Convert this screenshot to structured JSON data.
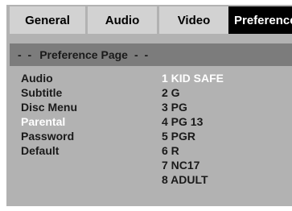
{
  "tabs": [
    {
      "label": "General",
      "active": false
    },
    {
      "label": "Audio",
      "active": false
    },
    {
      "label": "Video",
      "active": false
    },
    {
      "label": "Preference",
      "active": true
    }
  ],
  "page": {
    "title": "Preference Page",
    "prefix": "- -",
    "suffix": "- -"
  },
  "menu": {
    "items": [
      {
        "label": "Audio",
        "active": false
      },
      {
        "label": "Subtitle",
        "active": false
      },
      {
        "label": "Disc Menu",
        "active": false
      },
      {
        "label": "Parental",
        "active": true
      },
      {
        "label": "Password",
        "active": false
      },
      {
        "label": "Default",
        "active": false
      }
    ]
  },
  "options": {
    "items": [
      {
        "label": "1 KID SAFE",
        "selected": true
      },
      {
        "label": "2 G",
        "selected": false
      },
      {
        "label": "3 PG",
        "selected": false
      },
      {
        "label": "4 PG 13",
        "selected": false
      },
      {
        "label": "5 PGR",
        "selected": false
      },
      {
        "label": "6 R",
        "selected": false
      },
      {
        "label": "7 NC17",
        "selected": false
      },
      {
        "label": "8 ADULT",
        "selected": false
      }
    ]
  },
  "colors": {
    "panel": "#b2b2b2",
    "tab": "#d2d2d2",
    "active_tab": "#000000",
    "page_bar": "#7c7c7c",
    "highlight_text": "#ffffff"
  }
}
